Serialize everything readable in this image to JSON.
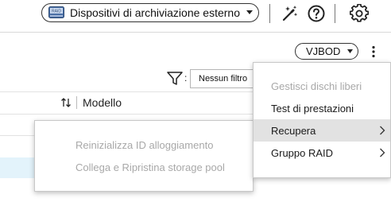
{
  "toolbar": {
    "storage_selector_label": "Dispositivi di archiviazione esterno",
    "storage_icon_text": "RAID"
  },
  "enclosure": {
    "selected": "VJBOD"
  },
  "filter": {
    "separator": ":",
    "value": "Nessun filtro"
  },
  "table": {
    "columns": [
      "Modello"
    ]
  },
  "context_menu": {
    "items": [
      {
        "label": "Gestisci dischi liberi",
        "state": "disabled"
      },
      {
        "label": "Test di prestazioni",
        "state": "enabled"
      },
      {
        "label": "Recupera",
        "state": "active",
        "has_submenu": true
      },
      {
        "label": "Gruppo RAID",
        "state": "enabled",
        "has_submenu": true
      }
    ]
  },
  "submenu": {
    "items": [
      {
        "label": "Reinizializza ID alloggiamento",
        "state": "disabled"
      },
      {
        "label": "Collega e Ripristina storage pool",
        "state": "disabled"
      }
    ]
  }
}
